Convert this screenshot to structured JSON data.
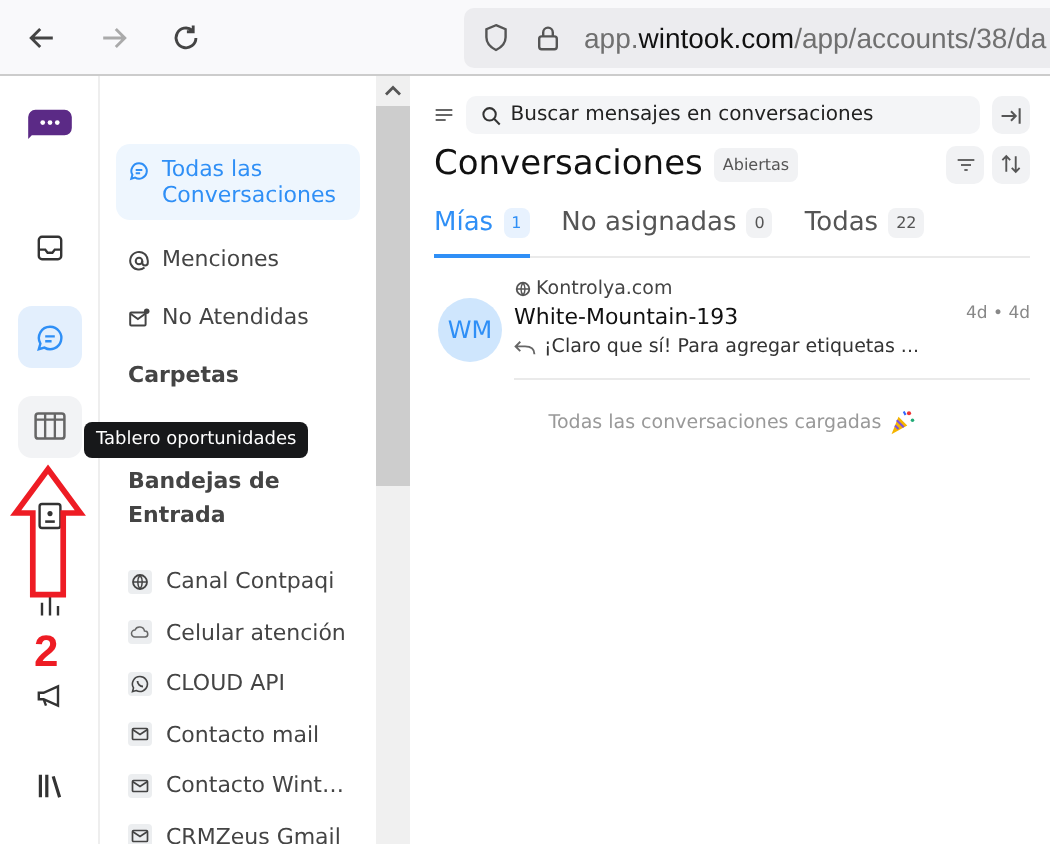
{
  "browser": {
    "url_prefix": "app.",
    "url_domain": "wintook.com",
    "url_path": "/app/accounts/38/da"
  },
  "rail": [
    {
      "kind": "inbox",
      "selected": false,
      "hovered": false
    },
    {
      "kind": "chat",
      "selected": true,
      "hovered": false
    },
    {
      "kind": "board",
      "selected": false,
      "hovered": true
    },
    {
      "kind": "contacts",
      "selected": false,
      "hovered": false
    },
    {
      "kind": "reports",
      "selected": false,
      "hovered": false
    },
    {
      "kind": "campaign",
      "selected": false,
      "hovered": false
    },
    {
      "kind": "library",
      "selected": false,
      "hovered": false
    }
  ],
  "tooltip": "Tablero oportunidades",
  "annotation": {
    "label": "2"
  },
  "sidebar": {
    "items": [
      {
        "label": "Todas las Conversaciones",
        "kind": "chat",
        "selected": true
      },
      {
        "label": "Menciones",
        "kind": "at",
        "selected": false
      },
      {
        "label": "No Atendidas",
        "kind": "unread",
        "selected": false
      }
    ],
    "folders_heading": "Carpetas",
    "inboxes_heading": "Bandejas de Entrada",
    "inboxes": [
      {
        "label": "Canal Contpaqi",
        "kind": "web"
      },
      {
        "label": "Celular atención",
        "kind": "cloud"
      },
      {
        "label": "CLOUD API",
        "kind": "whatsapp"
      },
      {
        "label": "Contacto mail",
        "kind": "mail"
      },
      {
        "label": "Contacto Wint…",
        "kind": "mail"
      },
      {
        "label": "CRMZeus Gmail",
        "kind": "mail"
      }
    ]
  },
  "main": {
    "search": {
      "placeholder": "Buscar mensajes en conversaciones"
    },
    "title": "Conversaciones",
    "status_badge": "Abiertas",
    "tabs": [
      {
        "label": "Mías",
        "count": "1",
        "selected": true
      },
      {
        "label": "No asignadas",
        "count": "0",
        "selected": false
      },
      {
        "label": "Todas",
        "count": "22",
        "selected": false
      }
    ],
    "conversations": [
      {
        "initials": "WM",
        "inbox": "Kontrolya.com",
        "name": "White-Mountain-193",
        "time": "4d • 4d",
        "preview": "¡Claro que sí! Para agregar etiquetas ..."
      }
    ],
    "end_note": "Todas las conversaciones cargadas"
  }
}
